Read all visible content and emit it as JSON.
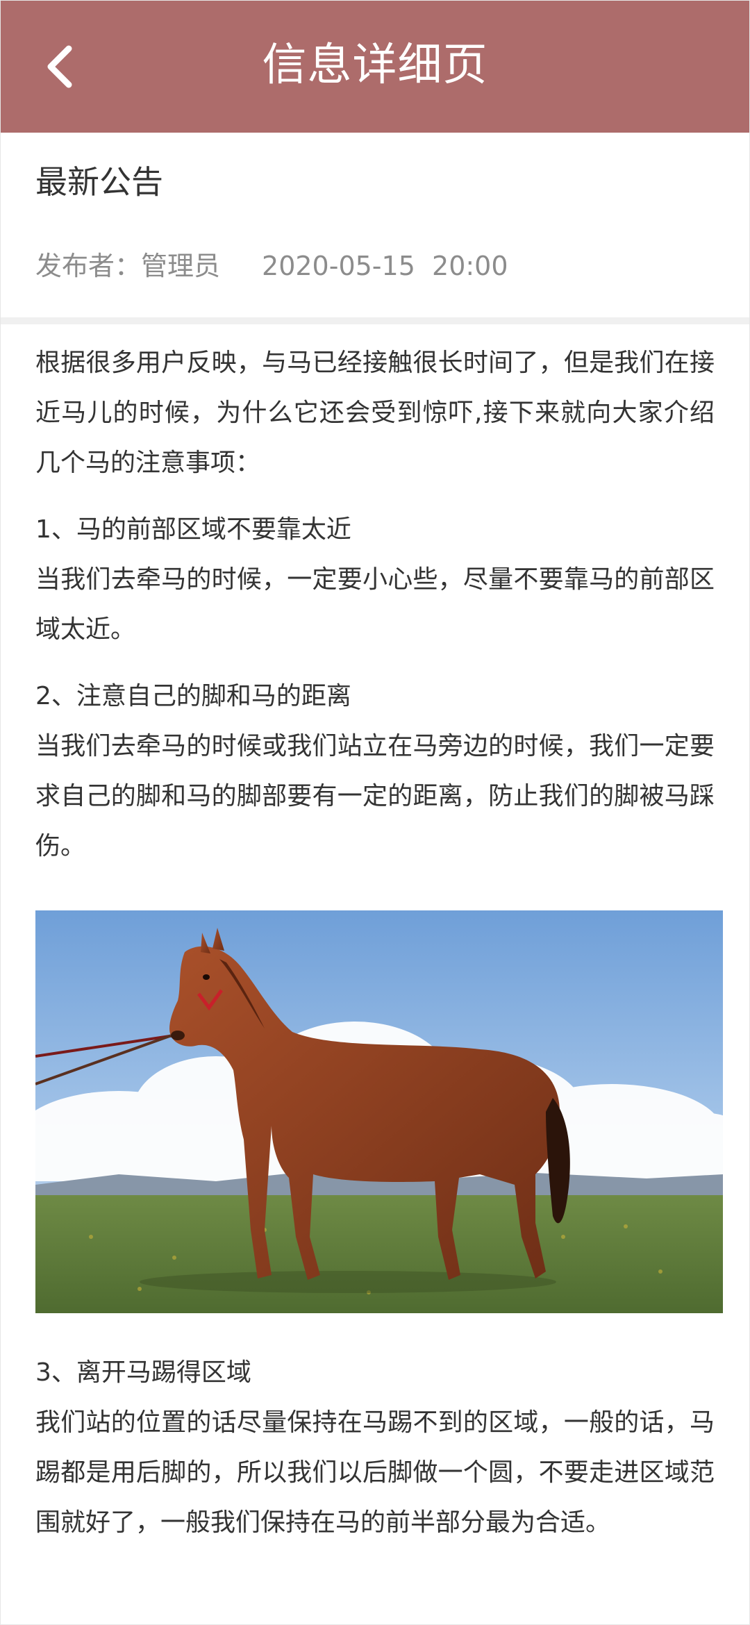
{
  "header": {
    "title": "信息详细页",
    "back_icon": "chevron-left-icon"
  },
  "article": {
    "title": "最新公告",
    "author_label": "发布者：",
    "author": "管理员",
    "datetime": "2020-05-15  20:00",
    "intro": "根据很多用户反映，与马已经接触很长时间了，但是我们在接近马儿的时候，为什么它还会受到惊吓,接下来就向大家介绍几个马的注意事项：",
    "sections": [
      {
        "heading": "1、马的前部区域不要靠太近",
        "body": "当我们去牵马的时候，一定要小心些，尽量不要靠马的前部区域太近。"
      },
      {
        "heading": "2、注意自己的脚和马的距离",
        "body": "当我们去牵马的时候或我们站立在马旁边的时候，我们一定要求自己的脚和马的脚部要有一定的距离，防止我们的脚被马踩伤。"
      },
      {
        "heading": "3、离开马踢得区域",
        "body": "我们站的位置的话尽量保持在马踢不到的区域，一般的话，马踢都是用后脚的，所以我们以后脚做一个圆，不要走进区域范围就好了，一般我们保持在马的前半部分最为合适。"
      }
    ]
  },
  "colors": {
    "header_bg": "#ad6c6b",
    "text": "#333333",
    "meta_text": "#8c8c8c",
    "divider": "#f0f0f0"
  }
}
